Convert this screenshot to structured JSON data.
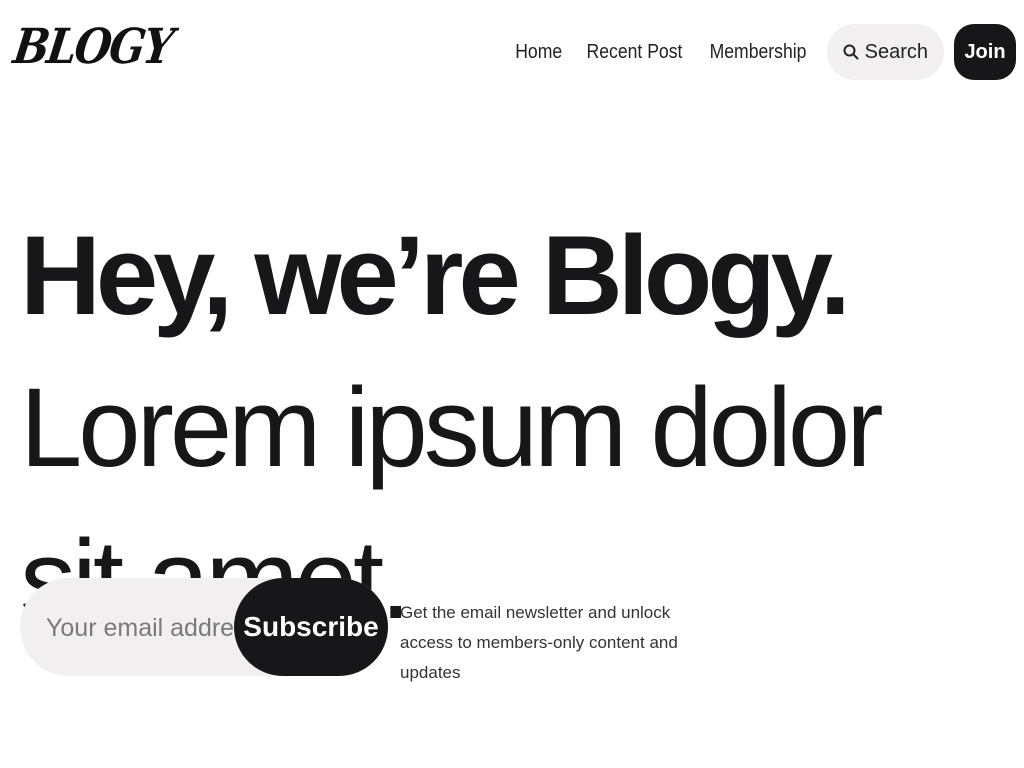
{
  "header": {
    "logo": "BLOGY",
    "nav": [
      "Home",
      "Recent Post",
      "Membership"
    ],
    "search_label": "Search",
    "join_label": "Join"
  },
  "hero": {
    "bold": "Hey, we’re Blogy.",
    "light": "Lorem ipsum dolor sit amet."
  },
  "subscribe": {
    "placeholder": "Your email address",
    "button_label": "Subscribe",
    "note": "Get the email newsletter and unlock access to members-only content and updates"
  },
  "colors": {
    "dark": "#17171a",
    "pill_bg": "#f1eff0",
    "background": "#ffffff"
  },
  "icons": {
    "search": "search-icon"
  }
}
